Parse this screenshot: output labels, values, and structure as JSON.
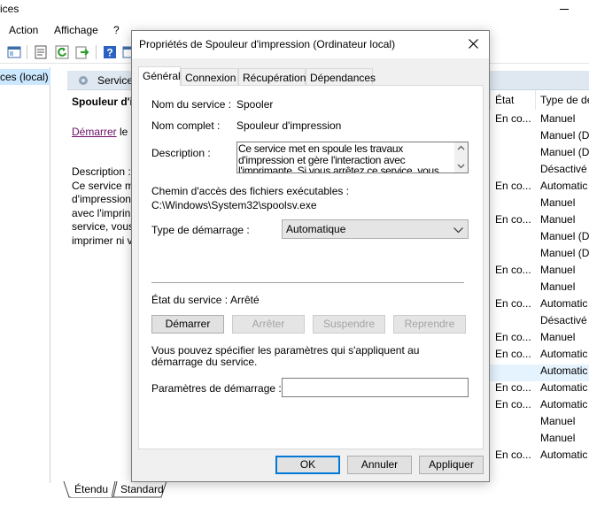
{
  "bg_window": {
    "title_fragment": "ices",
    "menu": [
      {
        "label": "Action"
      },
      {
        "label": "Affichage"
      },
      {
        "label": "?"
      }
    ],
    "tree_node": "ces (local)",
    "header_title": "Service",
    "extended": {
      "title": "Spouleur d'i",
      "link": "Démarrer",
      "link_suffix": " le s",
      "desc_label": "Description :",
      "desc_lines": [
        "Ce service m",
        "d'impression",
        "avec l'imprin",
        "service, vous",
        "imprimer ni v"
      ]
    },
    "columns": {
      "etat": "État",
      "type": "Type de dé"
    },
    "rows": [
      {
        "etat": "En co...",
        "type": "Manuel"
      },
      {
        "etat": "",
        "type": "Manuel (D"
      },
      {
        "etat": "",
        "type": "Manuel (D"
      },
      {
        "etat": "",
        "type": "Désactivé"
      },
      {
        "etat": "En co...",
        "type": "Automatic"
      },
      {
        "etat": "",
        "type": "Manuel"
      },
      {
        "etat": "En co...",
        "type": "Manuel"
      },
      {
        "etat": "",
        "type": "Manuel (D"
      },
      {
        "etat": "",
        "type": "Manuel (D"
      },
      {
        "etat": "En co...",
        "type": "Manuel"
      },
      {
        "etat": "",
        "type": "Manuel"
      },
      {
        "etat": "En co...",
        "type": "Automatic"
      },
      {
        "etat": "",
        "type": "Désactivé"
      },
      {
        "etat": "En co...",
        "type": "Manuel"
      },
      {
        "etat": "En co...",
        "type": "Automatic"
      },
      {
        "etat": "",
        "type": "Automatic"
      },
      {
        "etat": "En co...",
        "type": "Automatic"
      },
      {
        "etat": "En co...",
        "type": "Automatic"
      },
      {
        "etat": "",
        "type": "Manuel"
      },
      {
        "etat": "",
        "type": "Manuel"
      },
      {
        "etat": "En co...",
        "type": "Automatic"
      }
    ],
    "bottom_tabs": {
      "extended": "Étendu",
      "standard": "Standard"
    }
  },
  "dialog": {
    "title": "Propriétés de Spouleur d'impression (Ordinateur local)",
    "tabs": [
      "Général",
      "Connexion",
      "Récupération",
      "Dépendances"
    ],
    "service_name_label": "Nom du service :",
    "service_name": "Spooler",
    "display_name_label": "Nom complet :",
    "display_name": "Spouleur d'impression",
    "description_label": "Description :",
    "description": "Ce service met en spoule les travaux d'impression et gère l'interaction avec l'imprimante. Si vous arrêtez ce service, vous ne pourrez plus imprimer ni voir vos imprimantes.",
    "path_label": "Chemin d'accès des fichiers exécutables :",
    "path": "C:\\Windows\\System32\\spoolsv.exe",
    "startup_type_label": "Type de démarrage :",
    "startup_type": "Automatique",
    "status_label": "État du service :",
    "status": "Arrêté",
    "buttons": {
      "start": "Démarrer",
      "stop": "Arrêter",
      "pause": "Suspendre",
      "resume": "Reprendre"
    },
    "params_note": "Vous pouvez spécifier les paramètres qui s'appliquent au démarrage du service.",
    "params_label": "Paramètres de démarrage :",
    "params_value": "",
    "footer": {
      "ok": "OK",
      "cancel": "Annuler",
      "apply": "Appliquer"
    }
  }
}
